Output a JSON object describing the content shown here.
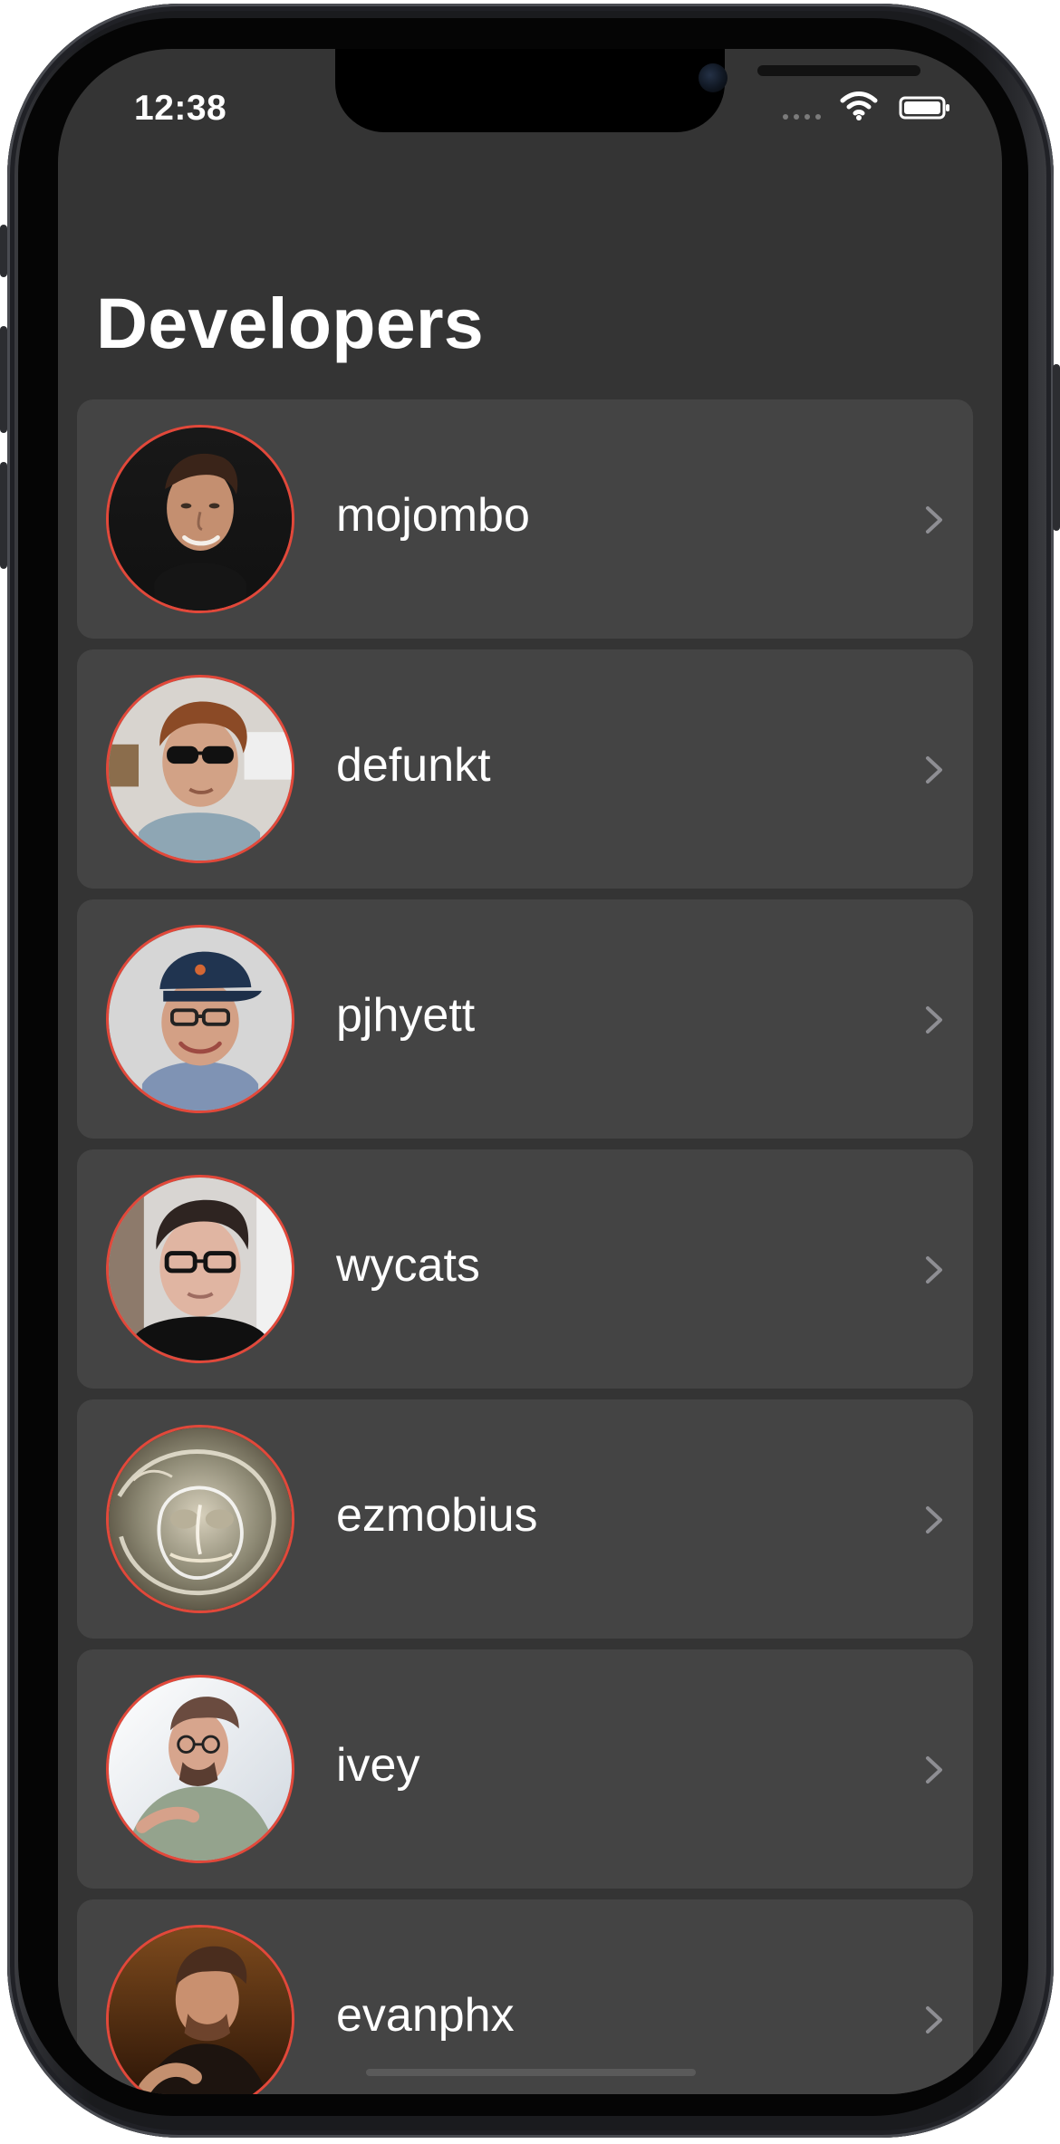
{
  "status_bar": {
    "time": "12:38"
  },
  "header": {
    "title": "Developers"
  },
  "developers": [
    {
      "username": "mojombo",
      "avatar_name": "mojombo-avatar"
    },
    {
      "username": "defunkt",
      "avatar_name": "defunkt-avatar"
    },
    {
      "username": "pjhyett",
      "avatar_name": "pjhyett-avatar"
    },
    {
      "username": "wycats",
      "avatar_name": "wycats-avatar"
    },
    {
      "username": "ezmobius",
      "avatar_name": "ezmobius-avatar"
    },
    {
      "username": "ivey",
      "avatar_name": "ivey-avatar"
    },
    {
      "username": "evanphx",
      "avatar_name": "evanphx-avatar"
    }
  ],
  "icons": {
    "chevron": "chevron-right-icon",
    "wifi": "wifi-icon",
    "battery": "battery-icon",
    "signal": "cellular-signal-icon"
  },
  "colors": {
    "background": "#343434",
    "row_background": "#444444",
    "avatar_border": "#e2483a",
    "chevron": "#8e8e93",
    "text": "#ffffff"
  }
}
